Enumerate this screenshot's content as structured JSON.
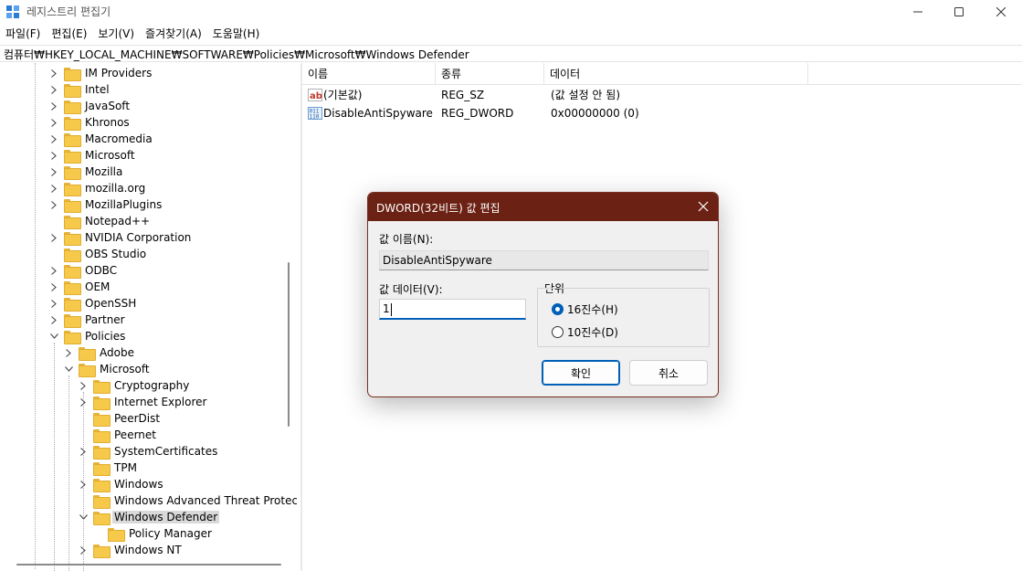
{
  "window": {
    "title": "레지스트리 편집기",
    "accent": "#6b2113"
  },
  "menu": [
    "파일(F)",
    "편집(E)",
    "보기(V)",
    "즐겨찾기(A)",
    "도움말(H)"
  ],
  "address": "컴퓨터₩HKEY_LOCAL_MACHINE₩SOFTWARE₩Policies₩Microsoft₩Windows Defender",
  "tree": {
    "items": [
      {
        "label": "IM Providers",
        "depth": 0,
        "expander": "closed"
      },
      {
        "label": "Intel",
        "depth": 0,
        "expander": "closed"
      },
      {
        "label": "JavaSoft",
        "depth": 0,
        "expander": "closed"
      },
      {
        "label": "Khronos",
        "depth": 0,
        "expander": "closed"
      },
      {
        "label": "Macromedia",
        "depth": 0,
        "expander": "closed"
      },
      {
        "label": "Microsoft",
        "depth": 0,
        "expander": "closed"
      },
      {
        "label": "Mozilla",
        "depth": 0,
        "expander": "closed"
      },
      {
        "label": "mozilla.org",
        "depth": 0,
        "expander": "closed"
      },
      {
        "label": "MozillaPlugins",
        "depth": 0,
        "expander": "closed"
      },
      {
        "label": "Notepad++",
        "depth": 0,
        "expander": "none"
      },
      {
        "label": "NVIDIA Corporation",
        "depth": 0,
        "expander": "closed"
      },
      {
        "label": "OBS Studio",
        "depth": 0,
        "expander": "none"
      },
      {
        "label": "ODBC",
        "depth": 0,
        "expander": "closed"
      },
      {
        "label": "OEM",
        "depth": 0,
        "expander": "closed"
      },
      {
        "label": "OpenSSH",
        "depth": 0,
        "expander": "closed"
      },
      {
        "label": "Partner",
        "depth": 0,
        "expander": "closed"
      },
      {
        "label": "Policies",
        "depth": 0,
        "expander": "open"
      },
      {
        "label": "Adobe",
        "depth": 1,
        "expander": "closed"
      },
      {
        "label": "Microsoft",
        "depth": 1,
        "expander": "open"
      },
      {
        "label": "Cryptography",
        "depth": 2,
        "expander": "closed"
      },
      {
        "label": "Internet Explorer",
        "depth": 2,
        "expander": "closed"
      },
      {
        "label": "PeerDist",
        "depth": 2,
        "expander": "none"
      },
      {
        "label": "Peernet",
        "depth": 2,
        "expander": "none"
      },
      {
        "label": "SystemCertificates",
        "depth": 2,
        "expander": "closed"
      },
      {
        "label": "TPM",
        "depth": 2,
        "expander": "none"
      },
      {
        "label": "Windows",
        "depth": 2,
        "expander": "closed"
      },
      {
        "label": "Windows Advanced Threat Protect",
        "depth": 2,
        "expander": "none"
      },
      {
        "label": "Windows Defender",
        "depth": 2,
        "expander": "open",
        "selected": true
      },
      {
        "label": "Policy Manager",
        "depth": 3,
        "expander": "none"
      },
      {
        "label": "Windows NT",
        "depth": 2,
        "expander": "closed"
      }
    ]
  },
  "list": {
    "columns": [
      "이름",
      "종류",
      "데이터"
    ],
    "rows": [
      {
        "icon": "string-value-icon",
        "name": "(기본값)",
        "type": "REG_SZ",
        "data": "(값 설정 안 됨)"
      },
      {
        "icon": "binary-value-icon",
        "name": "DisableAntiSpyware",
        "type": "REG_DWORD",
        "data": "0x00000000 (0)"
      }
    ]
  },
  "dialog": {
    "title": "DWORD(32비트) 값 편집",
    "name_label": "값 이름(N):",
    "name_value": "DisableAntiSpyware",
    "data_label": "값 데이터(V):",
    "data_value": "1",
    "base_label": "단위",
    "base_hex": "16진수(H)",
    "base_dec": "10진수(D)",
    "base_selected": "hex",
    "ok": "확인",
    "cancel": "취소"
  }
}
